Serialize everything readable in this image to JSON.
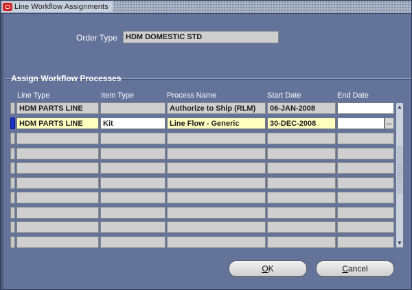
{
  "window": {
    "title": "Line Workflow Assignments"
  },
  "header": {
    "order_type_label": "Order Type",
    "order_type_value": "HDM DOMESTIC STD"
  },
  "section": {
    "title": "Assign Workflow Processes"
  },
  "table": {
    "columns": [
      "Line Type",
      "Item Type",
      "Process Name",
      "Start Date",
      "End Date"
    ],
    "rows": [
      {
        "line_type": "HDM PARTS LINE",
        "item_type": "",
        "process_name": "Authorize to Ship (RLM)",
        "start_date": "06-JAN-2008",
        "end_date": ""
      },
      {
        "line_type": "HDM PARTS LINE",
        "item_type": "Kit",
        "process_name": "Line Flow - Generic",
        "start_date": "30-DEC-2008",
        "end_date": ""
      }
    ],
    "lov_button_label": "...",
    "scroll_up_icon": "▲",
    "scroll_down_icon": "▼"
  },
  "buttons": {
    "ok": {
      "mnemonic": "O",
      "rest": "K"
    },
    "cancel": {
      "mnemonic": "C",
      "rest": "ancel"
    }
  },
  "colors": {
    "background": "#63739a",
    "required_field": "#ffffc0",
    "readonly_field": "#cfcfcf",
    "active_row_indicator": "#1b2fc9",
    "oracle_icon": "#d32020"
  }
}
